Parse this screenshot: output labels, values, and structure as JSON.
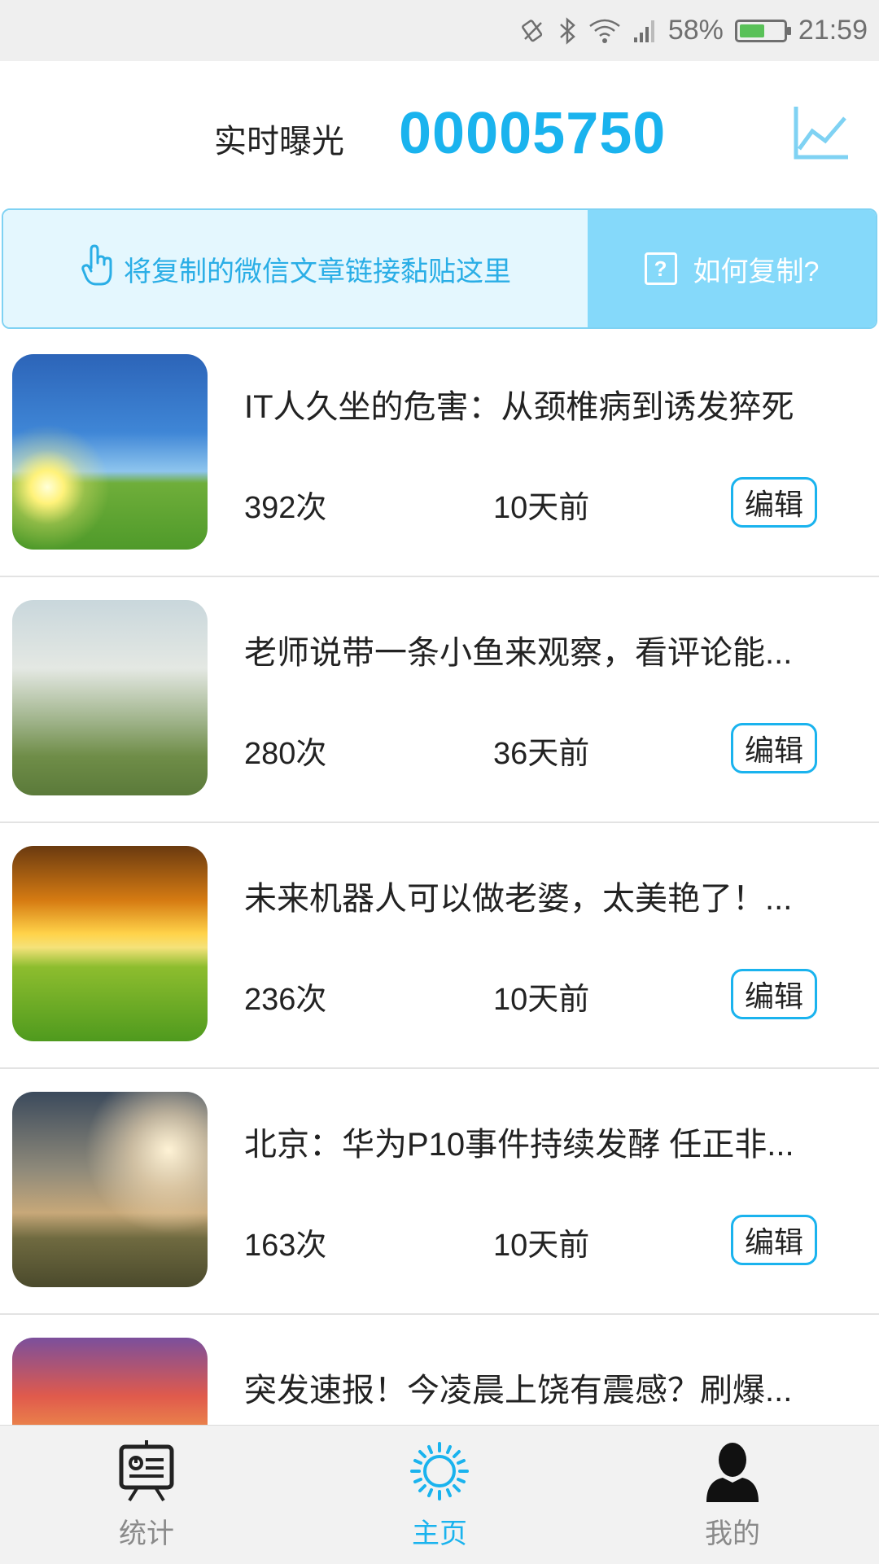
{
  "status_bar": {
    "battery_percent": "58%",
    "battery_level": 0.58,
    "time": "21:59",
    "icons": [
      "rotation-lock-icon",
      "bluetooth-icon",
      "wifi-icon",
      "signal-icon",
      "battery-icon"
    ]
  },
  "header": {
    "label": "实时曝光",
    "count": "00005750",
    "chart_icon": "line-chart-icon"
  },
  "paste_bar": {
    "hint": "将复制的微信文章链接黏贴这里",
    "hint_icon": "hand-pointer-icon",
    "help_label": "如何复制?",
    "help_icon": "question-box-icon"
  },
  "articles": [
    {
      "title": "IT人久坐的危害：从颈椎病到诱发猝死",
      "views": "392次",
      "time": "10天前",
      "edit_label": "编辑"
    },
    {
      "title": "老师说带一条小鱼来观察，看评论能...",
      "views": "280次",
      "time": "36天前",
      "edit_label": "编辑"
    },
    {
      "title": "未来机器人可以做老婆，太美艳了！...",
      "views": "236次",
      "time": "10天前",
      "edit_label": "编辑"
    },
    {
      "title": "北京：华为P10事件持续发酵 任正非...",
      "views": "163次",
      "time": "10天前",
      "edit_label": "编辑"
    },
    {
      "title": "突发速报！今凌晨上饶有震感？刷爆...",
      "views": "",
      "time": "",
      "edit_label": ""
    }
  ],
  "bottom_nav": {
    "stats_label": "统计",
    "home_label": "主页",
    "mine_label": "我的",
    "active_color": "#1ab3ee"
  },
  "colors": {
    "accent": "#1ab3ee",
    "paste_bg": "#e4f7fe",
    "help_bg": "#85d9fa"
  }
}
